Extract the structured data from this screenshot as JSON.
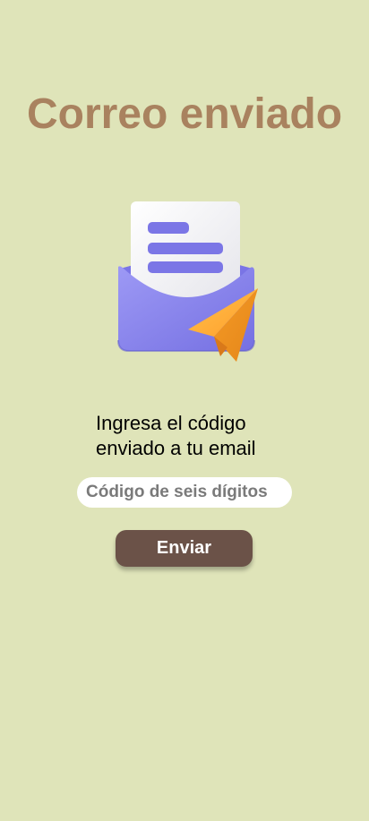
{
  "page": {
    "title": "Correo enviado"
  },
  "illustration": {
    "icon": "envelope-with-letter-and-paper-plane-icon",
    "colors": {
      "envelope": "#8b86ee",
      "letter": "#f1f1f3",
      "lines": "#7b76e6",
      "plane": "#ffaf3a"
    }
  },
  "instruction": {
    "line1": "Ingresa el código",
    "line2": "enviado a tu email"
  },
  "code_input": {
    "placeholder": "Código de seis dígitos",
    "value": ""
  },
  "send_button": {
    "label": "Enviar"
  },
  "colors": {
    "background": "#dfe4b9",
    "title": "#a9825f",
    "button": "#6b5248"
  }
}
